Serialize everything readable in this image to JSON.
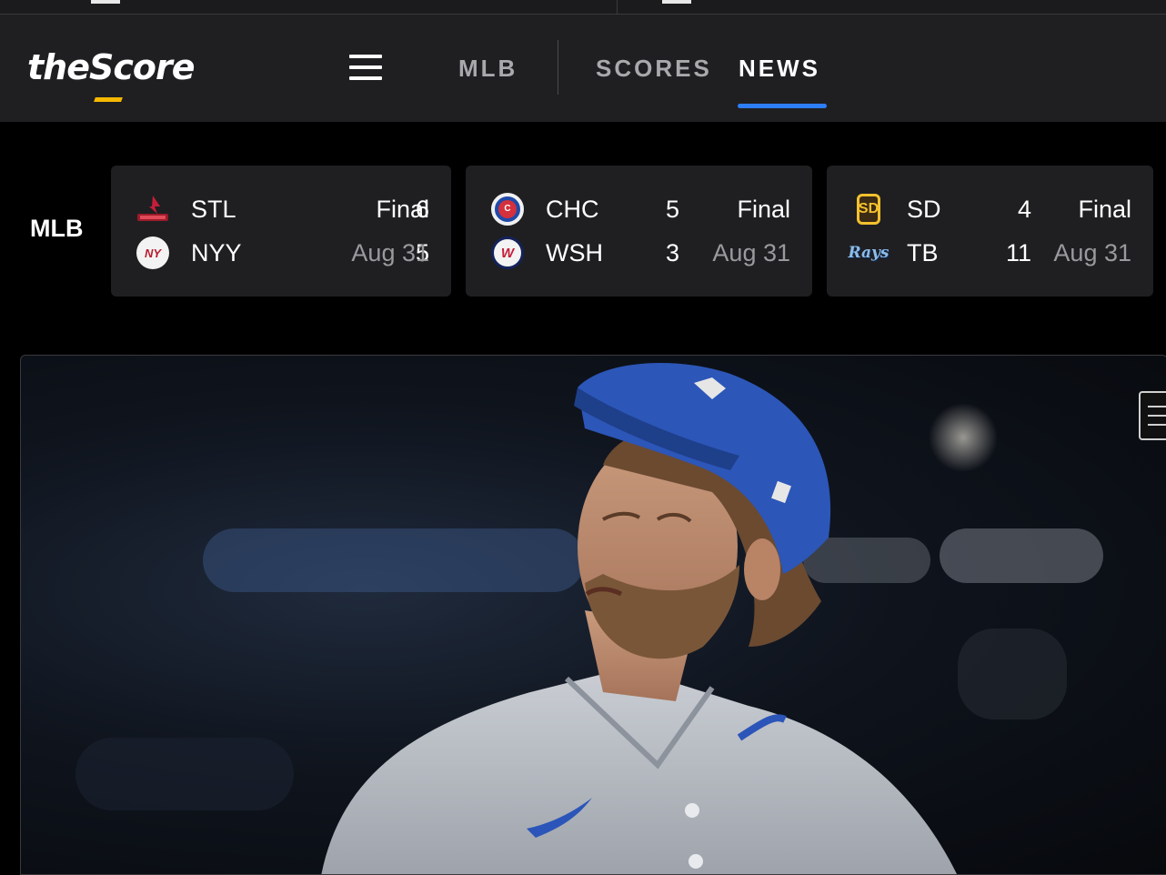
{
  "header": {
    "logo_text": "theScore",
    "nav": {
      "league": "MLB",
      "scores": "SCORES",
      "news": "NEWS"
    },
    "active_tab": "news",
    "accent_color": "#2d7ff9",
    "logo_accent_color": "#f5b800"
  },
  "scores_strip": {
    "league_label": "MLB",
    "games": [
      {
        "away": {
          "abbr": "STL",
          "score": "6",
          "icon": "cardinals-logo-icon"
        },
        "home": {
          "abbr": "NYY",
          "score": "5",
          "icon": "yankees-logo-icon"
        },
        "status": "Final",
        "date": "Aug 31"
      },
      {
        "away": {
          "abbr": "CHC",
          "score": "5",
          "icon": "cubs-logo-icon"
        },
        "home": {
          "abbr": "WSH",
          "score": "3",
          "icon": "nationals-logo-icon"
        },
        "status": "Final",
        "date": "Aug 31"
      },
      {
        "away": {
          "abbr": "SD",
          "score": "4",
          "icon": "padres-logo-icon"
        },
        "home": {
          "abbr": "TB",
          "score": "11",
          "icon": "rays-logo-icon"
        },
        "status": "Final",
        "date": "Aug 31"
      }
    ]
  },
  "hero": {
    "image_subject": "baseball pitcher in blue cap and grey jersey"
  }
}
